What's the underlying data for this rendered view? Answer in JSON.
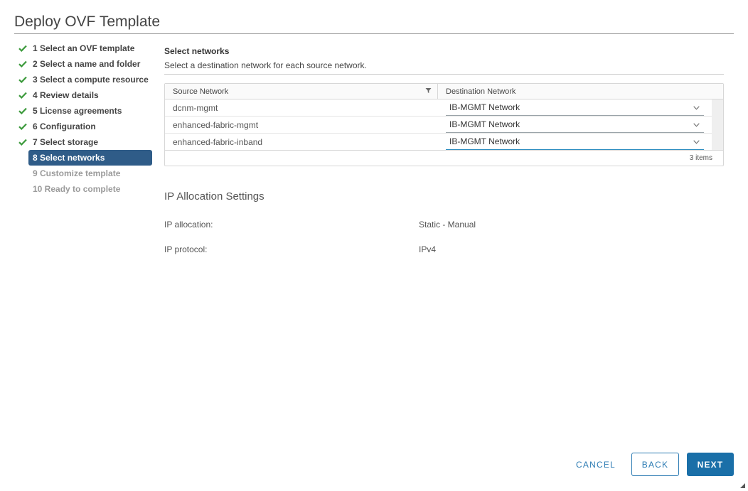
{
  "window": {
    "title": "Deploy OVF Template"
  },
  "steps": [
    {
      "label": "1 Select an OVF template",
      "state": "done"
    },
    {
      "label": "2 Select a name and folder",
      "state": "done"
    },
    {
      "label": "3 Select a compute resource",
      "state": "done"
    },
    {
      "label": "4 Review details",
      "state": "done"
    },
    {
      "label": "5 License agreements",
      "state": "done"
    },
    {
      "label": "6 Configuration",
      "state": "done"
    },
    {
      "label": "7 Select storage",
      "state": "done"
    },
    {
      "label": "8 Select networks",
      "state": "active"
    },
    {
      "label": "9 Customize template",
      "state": "pending"
    },
    {
      "label": "10 Ready to complete",
      "state": "pending"
    }
  ],
  "main": {
    "heading": "Select networks",
    "description": "Select a destination network for each source network."
  },
  "grid": {
    "columns": {
      "source": "Source Network",
      "destination": "Destination Network"
    },
    "rows": [
      {
        "source": "dcnm-mgmt",
        "destination": "IB-MGMT Network"
      },
      {
        "source": "enhanced-fabric-mgmt",
        "destination": "IB-MGMT Network"
      },
      {
        "source": "enhanced-fabric-inband",
        "destination": "IB-MGMT Network"
      }
    ],
    "footer": "3 items"
  },
  "ip_settings": {
    "heading": "IP Allocation Settings",
    "allocation_label": "IP allocation:",
    "allocation_value": "Static - Manual",
    "protocol_label": "IP protocol:",
    "protocol_value": "IPv4"
  },
  "buttons": {
    "cancel": "CANCEL",
    "back": "BACK",
    "next": "NEXT"
  },
  "colors": {
    "check": "#3c9a3c",
    "active_step": "#2f5c88",
    "primary": "#1a6fa8",
    "link": "#2c7bb3"
  }
}
